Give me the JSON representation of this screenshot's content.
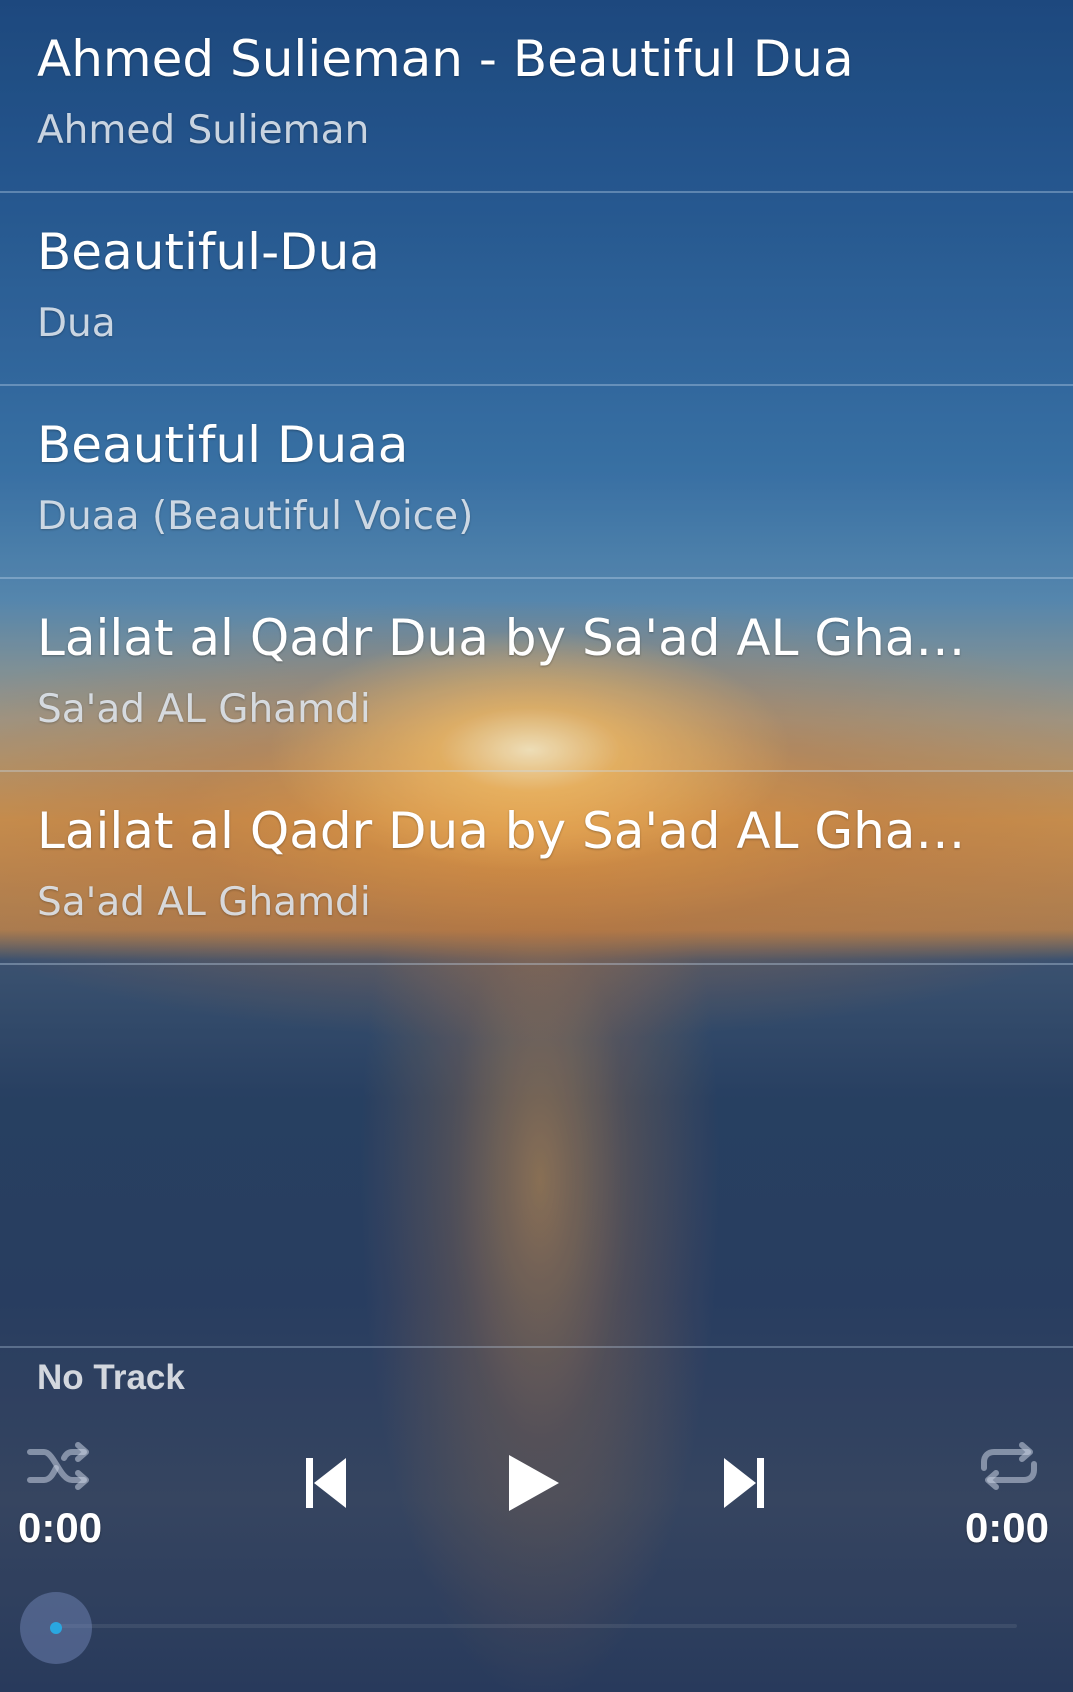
{
  "tracks": [
    {
      "title": "Ahmed Sulieman - Beautiful Dua",
      "artist": "Ahmed Sulieman"
    },
    {
      "title": "Beautiful-Dua",
      "artist": "Dua"
    },
    {
      "title": "Beautiful Duaa",
      "artist": "Duaa (Beautiful Voice)"
    },
    {
      "title": "Lailat al Qadr Dua by Sa'ad AL Ghamd…",
      "artist": "Sa'ad AL Ghamdi"
    },
    {
      "title": "Lailat al Qadr Dua by Sa'ad AL Ghamd…",
      "artist": "Sa'ad AL Ghamdi"
    }
  ],
  "player": {
    "now_playing": "No Track",
    "elapsed": "0:00",
    "duration": "0:00",
    "progress": 0,
    "icons": {
      "shuffle": "shuffle-icon",
      "previous": "skip-previous-icon",
      "play": "play-icon",
      "next": "skip-next-icon",
      "repeat": "repeat-icon"
    }
  },
  "colors": {
    "accent": "#2aa7e0",
    "divider": "#c8dcf0"
  }
}
